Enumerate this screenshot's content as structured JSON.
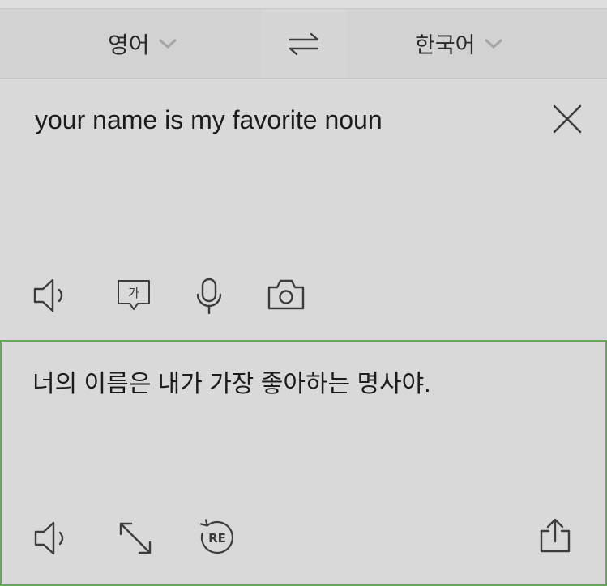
{
  "language_bar": {
    "source_language": "영어",
    "target_language": "한국어",
    "source_chevron_icon": "chevron-down-icon",
    "target_chevron_icon": "chevron-down-icon",
    "swap_icon": "swap-arrows-icon"
  },
  "input": {
    "text": "your name is my favorite noun",
    "clear_icon": "close-icon",
    "tools": {
      "speak_icon": "speaker-icon",
      "handwriting_icon": "handwriting-bubble-icon",
      "handwriting_glyph": "가",
      "voice_icon": "microphone-icon",
      "camera_icon": "camera-icon"
    }
  },
  "output": {
    "text": "너의 이름은 내가 가장 좋아하는 명사야.",
    "tools": {
      "speak_icon": "speaker-icon",
      "expand_icon": "expand-arrows-icon",
      "retranslate_icon": "retranslate-icon",
      "retranslate_glyph": "RE",
      "share_icon": "share-icon"
    }
  },
  "colors": {
    "output_border": "#6aa55f",
    "text": "#1c1c1c",
    "icon": "#3c3c3c",
    "chevron": "#a5a5a5"
  }
}
